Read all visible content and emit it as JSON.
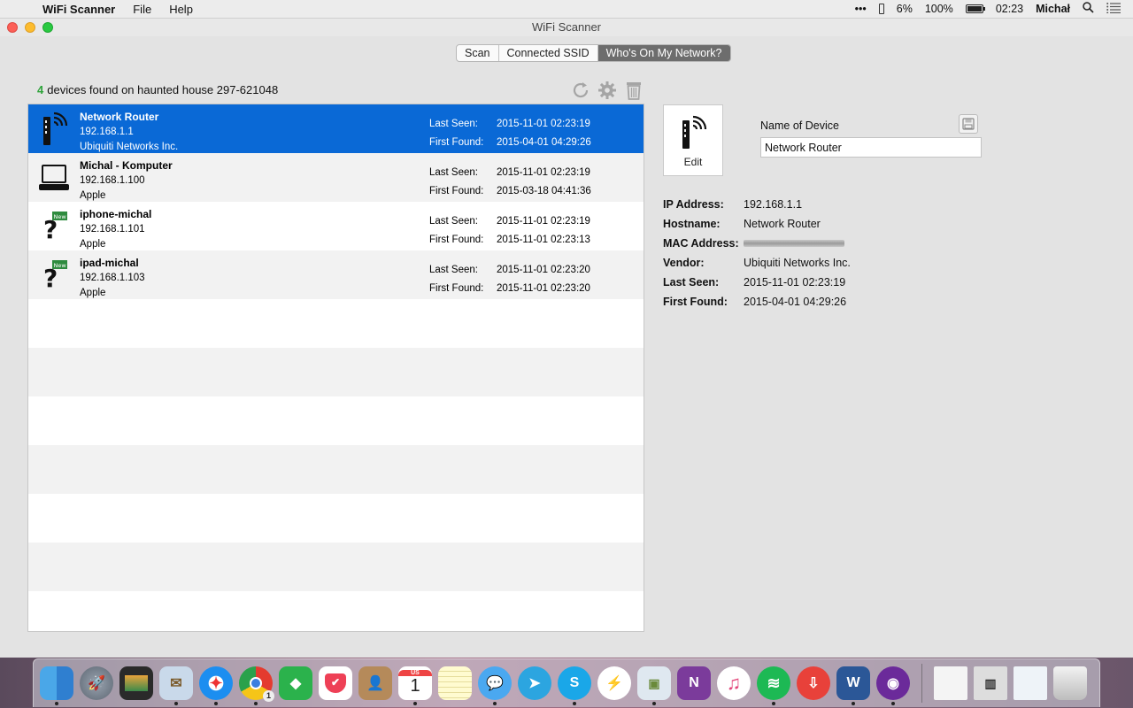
{
  "menubar": {
    "app_name": "WiFi Scanner",
    "menus": [
      "File",
      "Help"
    ],
    "status": {
      "more": "•••",
      "percent1": "6%",
      "battery": "100%",
      "time": "02:23",
      "user": "Michał"
    }
  },
  "window": {
    "title": "WiFi Scanner",
    "tabs": [
      "Scan",
      "Connected SSID",
      "Who's On My Network?"
    ],
    "active_tab": "Who's On My Network?"
  },
  "summary": {
    "count": "4",
    "text": "devices found on haunted house 297-621048"
  },
  "devices": [
    {
      "name": "Network Router",
      "ip": "192.168.1.1",
      "vendor": "Ubiquiti Networks Inc.",
      "last_seen_label": "Last Seen:",
      "last_seen": "2015-11-01 02:23:19",
      "first_found_label": "First Found:",
      "first_found": "2015-04-01 04:29:26",
      "icon": "router-icon",
      "selected": true
    },
    {
      "name": "Michal - Komputer",
      "ip": "192.168.1.100",
      "vendor": "Apple",
      "last_seen_label": "Last Seen:",
      "last_seen": "2015-11-01 02:23:19",
      "first_found_label": "First Found:",
      "first_found": "2015-03-18 04:41:36",
      "icon": "laptop-icon",
      "selected": false
    },
    {
      "name": "iphone-michal",
      "ip": "192.168.1.101",
      "vendor": "Apple",
      "last_seen_label": "Last Seen:",
      "last_seen": "2015-11-01 02:23:19",
      "first_found_label": "First Found:",
      "first_found": "2015-11-01 02:23:13",
      "icon": "unknown-device-new-icon",
      "selected": false
    },
    {
      "name": "ipad-michal",
      "ip": "192.168.1.103",
      "vendor": "Apple",
      "last_seen_label": "Last Seen:",
      "last_seen": "2015-11-01 02:23:20",
      "first_found_label": "First Found:",
      "first_found": "2015-11-01 02:23:20",
      "icon": "unknown-device-new-icon",
      "selected": false
    }
  ],
  "new_badge": "New",
  "detail": {
    "edit_label": "Edit",
    "name_label": "Name of Device",
    "name_value": "Network Router",
    "properties": [
      {
        "key": "IP Address:",
        "value": "192.168.1.1"
      },
      {
        "key": "Hostname:",
        "value": "Network Router"
      },
      {
        "key": "MAC Address:",
        "value": ""
      },
      {
        "key": "Vendor:",
        "value": "Ubiquiti Networks Inc."
      },
      {
        "key": "Last Seen:",
        "value": "2015-11-01 02:23:19"
      },
      {
        "key": "First Found:",
        "value": "2015-04-01 04:29:26"
      }
    ]
  },
  "dock": {
    "calendar": {
      "month": "US",
      "day": "1"
    },
    "chrome_badge": "1",
    "apps": [
      "finder",
      "launchpad",
      "photo-slideshow",
      "mail-bird",
      "safari",
      "chrome",
      "feedly",
      "pocket",
      "contacts",
      "calendar",
      "notes",
      "messages",
      "telegram",
      "skype",
      "messenger",
      "preview",
      "onenote",
      "itunes",
      "spotify",
      "pdf-app",
      "word",
      "wifi-scanner",
      "document",
      "file-manager",
      "doc-thumbnail",
      "trash"
    ]
  }
}
